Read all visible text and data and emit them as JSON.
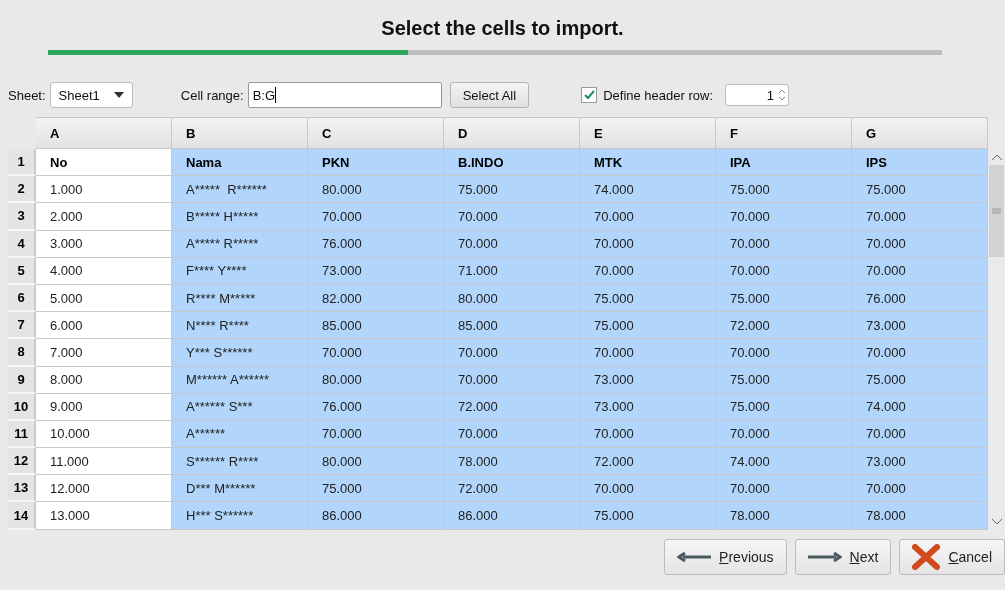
{
  "title": "Select the cells to import.",
  "progress": {
    "level": 0.403
  },
  "toolbar": {
    "sheet_label": "Sheet:",
    "sheet_value": "Sheet1",
    "range_label": "Cell range:",
    "range_value": "B:G",
    "select_all": "Select All",
    "header_row_checked": true,
    "header_row_label": "Define header row:",
    "header_row_value": "1"
  },
  "table": {
    "columns": [
      {
        "label": "A",
        "selected": false
      },
      {
        "label": "B",
        "selected": true
      },
      {
        "label": "C",
        "selected": true
      },
      {
        "label": "D",
        "selected": true
      },
      {
        "label": "E",
        "selected": true
      },
      {
        "label": "F",
        "selected": true
      },
      {
        "label": "G",
        "selected": true
      }
    ],
    "rows": [
      {
        "number": "1",
        "kind": "header",
        "cells": [
          "No",
          "Nama",
          "PKN",
          "B.INDO",
          "MTK",
          "IPA",
          "IPS"
        ]
      },
      {
        "number": "2",
        "kind": "data",
        "cells": [
          "1.000",
          "A*****  R******",
          "80.000",
          "75.000",
          "74.000",
          "75.000",
          "75.000"
        ]
      },
      {
        "number": "3",
        "kind": "data",
        "cells": [
          "2.000",
          "B***** H*****",
          "70.000",
          "70.000",
          "70.000",
          "70.000",
          "70.000"
        ]
      },
      {
        "number": "4",
        "kind": "data",
        "cells": [
          "3.000",
          "A***** R*****",
          "76.000",
          "70.000",
          "70.000",
          "70.000",
          "70.000"
        ]
      },
      {
        "number": "5",
        "kind": "data",
        "cells": [
          "4.000",
          "F**** Y****",
          "73.000",
          "71.000",
          "70.000",
          "70.000",
          "70.000"
        ]
      },
      {
        "number": "6",
        "kind": "data",
        "cells": [
          "5.000",
          "R**** M*****",
          "82.000",
          "80.000",
          "75.000",
          "75.000",
          "76.000"
        ]
      },
      {
        "number": "7",
        "kind": "data",
        "cells": [
          "6.000",
          "N**** R****",
          "85.000",
          "85.000",
          "75.000",
          "72.000",
          "73.000"
        ]
      },
      {
        "number": "8",
        "kind": "data",
        "cells": [
          "7.000",
          "Y*** S******",
          "70.000",
          "70.000",
          "70.000",
          "70.000",
          "70.000"
        ]
      },
      {
        "number": "9",
        "kind": "data",
        "cells": [
          "8.000",
          "M****** A******",
          "80.000",
          "70.000",
          "73.000",
          "75.000",
          "75.000"
        ]
      },
      {
        "number": "10",
        "kind": "data",
        "cells": [
          "9.000",
          "A****** S***",
          "76.000",
          "72.000",
          "73.000",
          "75.000",
          "74.000"
        ]
      },
      {
        "number": "11",
        "kind": "data",
        "cells": [
          "10.000",
          "A******",
          "70.000",
          "70.000",
          "70.000",
          "70.000",
          "70.000"
        ]
      },
      {
        "number": "12",
        "kind": "data",
        "cells": [
          "11.000",
          "S****** R****",
          "80.000",
          "78.000",
          "72.000",
          "74.000",
          "73.000"
        ]
      },
      {
        "number": "13",
        "kind": "data",
        "cells": [
          "12.000",
          "D*** M******",
          "75.000",
          "72.000",
          "70.000",
          "70.000",
          "70.000"
        ]
      },
      {
        "number": "14",
        "kind": "data",
        "cells": [
          "13.000",
          "H*** S******",
          "86.000",
          "86.000",
          "75.000",
          "78.000",
          "78.000"
        ]
      }
    ]
  },
  "buttons": [
    {
      "kind": "previous",
      "label": "Previous"
    },
    {
      "kind": "next",
      "label": "Next"
    },
    {
      "kind": "cancel",
      "label": "Cancel"
    }
  ]
}
